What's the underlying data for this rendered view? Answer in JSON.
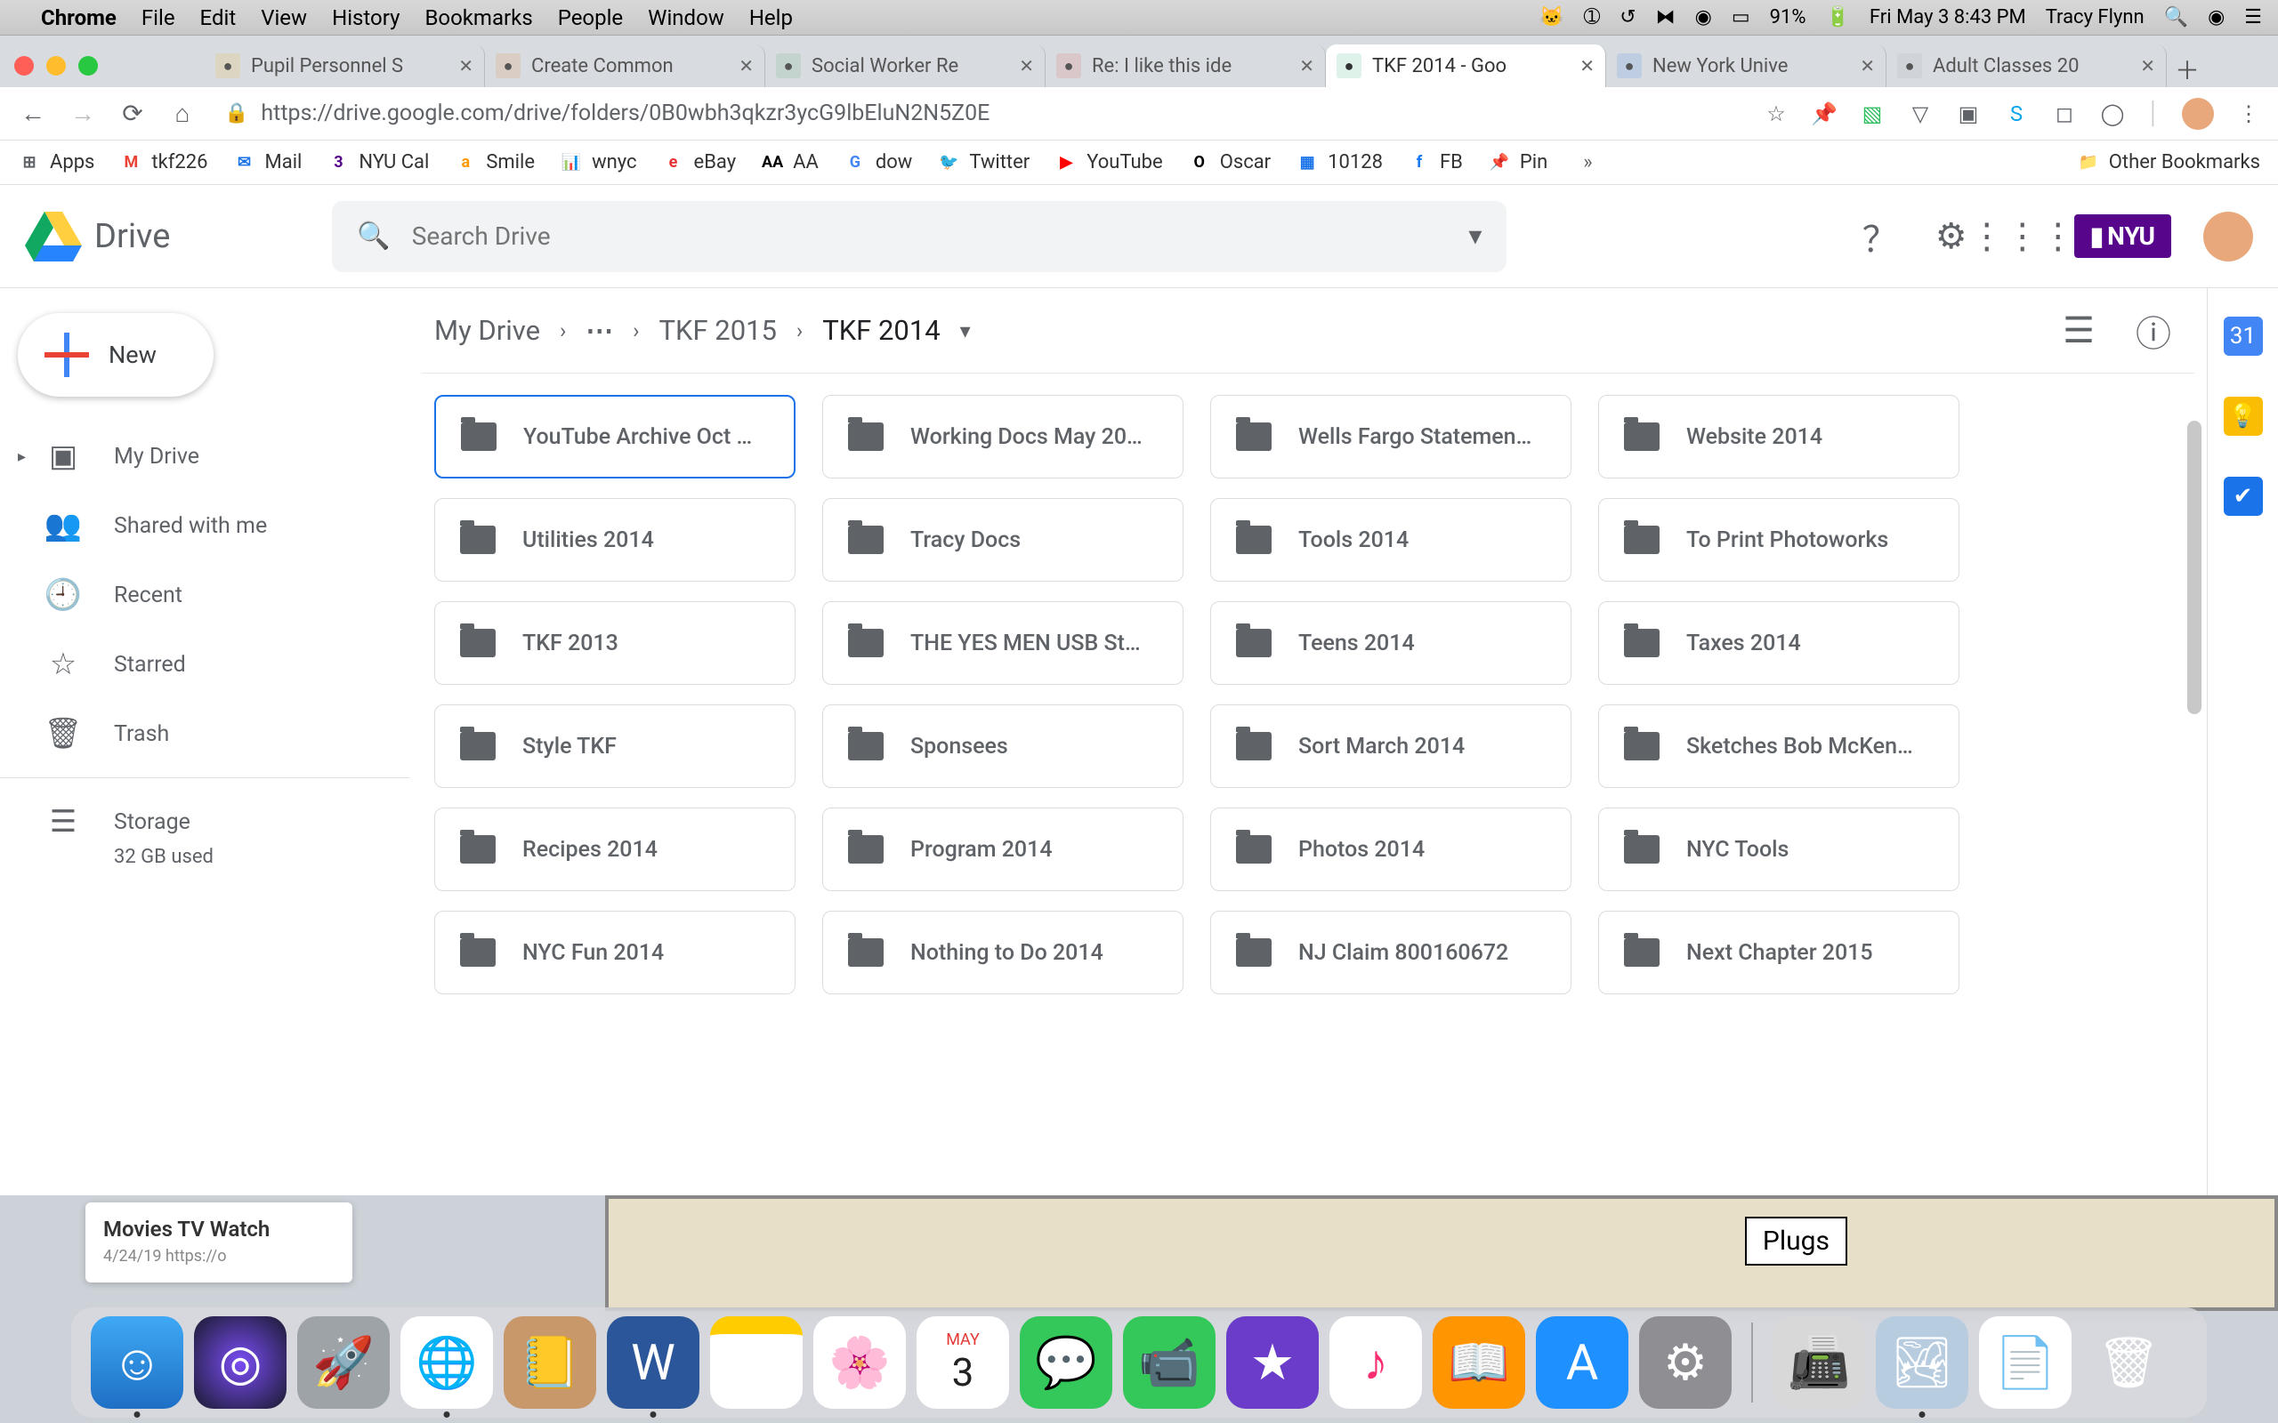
{
  "menubar": {
    "app": "Chrome",
    "items": [
      "File",
      "Edit",
      "View",
      "History",
      "Bookmarks",
      "People",
      "Window",
      "Help"
    ],
    "battery": "91%",
    "datetime": "Fri May 3  8:43 PM",
    "user": "Tracy Flynn"
  },
  "tabs": [
    {
      "title": "Pupil Personnel S"
    },
    {
      "title": "Create Common"
    },
    {
      "title": "Social Worker Re"
    },
    {
      "title": "Re: I like this ide"
    },
    {
      "title": "TKF 2014 - Goo",
      "active": true
    },
    {
      "title": "New York Unive"
    },
    {
      "title": "Adult Classes 20"
    }
  ],
  "url": {
    "host": "https://drive.google.com",
    "path": "/drive/folders/0B0wbh3qkzr3ycG9lbEluN2N5Z0E"
  },
  "bookmarks": [
    "Apps",
    "tkf226",
    "Mail",
    "NYU Cal",
    "Smile",
    "wnyc",
    "eBay",
    "AA",
    "dow",
    "Twitter",
    "YouTube",
    "Oscar",
    "10128",
    "FB",
    "Pin"
  ],
  "otherbm": "Other Bookmarks",
  "drive": {
    "product": "Drive",
    "search_placeholder": "Search Drive",
    "nyu": "NYU",
    "newbtn": "New",
    "side": [
      {
        "icon": "▣",
        "label": "My Drive"
      },
      {
        "icon": "👥",
        "label": "Shared with me"
      },
      {
        "icon": "🕘",
        "label": "Recent"
      },
      {
        "icon": "☆",
        "label": "Starred"
      },
      {
        "icon": "🗑",
        "label": "Trash"
      }
    ],
    "storage": {
      "label": "Storage",
      "used": "32 GB used"
    },
    "crumbs": [
      "My Drive",
      "…",
      "TKF 2015",
      "TKF 2014"
    ],
    "folders": [
      "YouTube Archive Oct …",
      "Working Docs May 20…",
      "Wells Fargo Statemen…",
      "Website 2014",
      "Utilities 2014",
      "Tracy Docs",
      "Tools 2014",
      "To Print Photoworks",
      "TKF 2013",
      "THE YES MEN USB St…",
      "Teens 2014",
      "Taxes 2014",
      "Style TKF",
      "Sponsees",
      "Sort March 2014",
      "Sketches Bob McKen…",
      "Recipes 2014",
      "Program 2014",
      "Photos 2014",
      "NYC Tools",
      "NYC Fun 2014",
      "Nothing to Do 2014",
      "NJ Claim 800160672",
      "Next Chapter 2015"
    ]
  },
  "below": {
    "card_title": "Movies TV Watch",
    "card_sub": "4/24/19  https://o",
    "plug": "Plugs"
  },
  "dock": {
    "cal_month": "MAY",
    "cal_day": "3"
  }
}
